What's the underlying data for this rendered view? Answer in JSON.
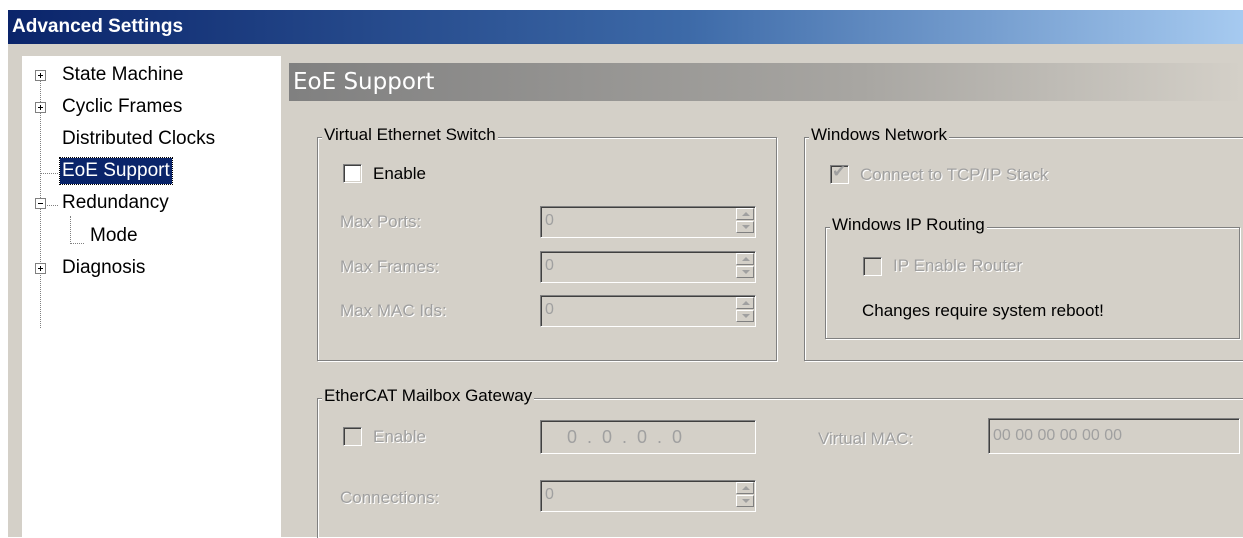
{
  "window": {
    "title": "Advanced Settings"
  },
  "tree": {
    "items": [
      {
        "label": "State Machine",
        "expander": "plus"
      },
      {
        "label": "Cyclic Frames",
        "expander": "plus"
      },
      {
        "label": "Distributed Clocks",
        "expander": "none"
      },
      {
        "label": "EoE Support",
        "expander": "none",
        "selected": true
      },
      {
        "label": "Redundancy",
        "expander": "minus"
      },
      {
        "label": "Mode",
        "expander": "none"
      },
      {
        "label": "Diagnosis",
        "expander": "plus"
      }
    ]
  },
  "panel": {
    "title": "EoE Support"
  },
  "virtual_switch": {
    "legend": "Virtual Ethernet Switch",
    "enable_label": "Enable",
    "enable_checked": false,
    "max_ports_label": "Max Ports:",
    "max_ports_value": "0",
    "max_frames_label": "Max Frames:",
    "max_frames_value": "0",
    "max_macids_label": "Max MAC Ids:",
    "max_macids_value": "0"
  },
  "windows_network": {
    "legend": "Windows Network",
    "connect_label": "Connect to TCP/IP Stack",
    "connect_checked": true,
    "ip_routing": {
      "legend": "Windows IP Routing",
      "enable_router_label": "IP Enable Router",
      "enable_router_checked": false,
      "reboot_note": "Changes require system reboot!"
    }
  },
  "mailbox_gateway": {
    "legend": "EtherCAT Mailbox Gateway",
    "enable_label": "Enable",
    "enable_checked": false,
    "ip_value": "0  .  0  .  0  .  0",
    "virtual_mac_label": "Virtual MAC:",
    "virtual_mac_value": "00 00 00 00 00 00",
    "connections_label": "Connections:",
    "connections_value": "0"
  },
  "icons": {
    "checkmark": "checkmark-icon",
    "spin_up": "spin-up-icon",
    "spin_down": "spin-down-icon",
    "expand": "expand-plus-icon",
    "collapse": "collapse-minus-icon"
  },
  "colors": {
    "titlebar_start": "#0a246a",
    "titlebar_end": "#a6caf0",
    "selection": "#0a246a",
    "dialog_face": "#d4d0c8",
    "disabled_text": "#a0a0a0"
  }
}
